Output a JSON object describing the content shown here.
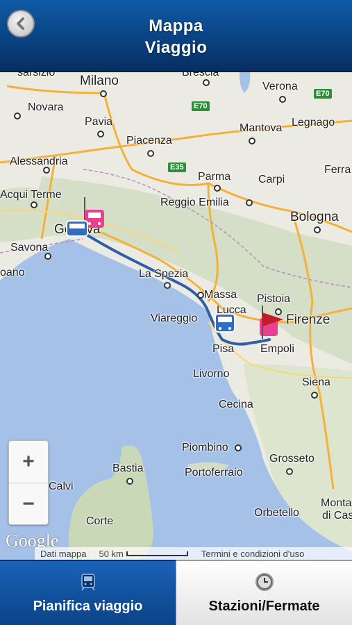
{
  "header": {
    "title_line1": "Mappa",
    "title_line2": "Viaggio",
    "back_icon": "chevron-left-icon"
  },
  "map": {
    "cities": {
      "milano": "Milano",
      "novara": "Novara",
      "pavia": "Pavia",
      "piacenza": "Piacenza",
      "alessandria": "Alessandria",
      "acqui": "Acqui Terme",
      "parma": "Parma",
      "reggio": "Reggio Emilia",
      "bologna": "Bologna",
      "carpi": "Carpi",
      "mantova": "Mantova",
      "legnago": "Legnago",
      "verona": "Verona",
      "brescia": "Brescia",
      "ferrara": "Ferra",
      "genova": "Genova",
      "savona": "Savona",
      "laspezia": "La Spezia",
      "massa": "Massa",
      "viareggio": "Viareggio",
      "lucca": "Lucca",
      "pistoia": "Pistoia",
      "firenze": "Firenze",
      "pisa": "Pisa",
      "empoli": "Empoli",
      "livorno": "Livorno",
      "siena": "Siena",
      "cecina": "Cecina",
      "piombino": "Piombino",
      "portoferraio": "Portoferraio",
      "grosseto": "Grosseto",
      "bastia": "Bastia",
      "calvi": "Calvi",
      "corte": "Corte",
      "orbetello": "Orbetello",
      "monta": "Monta",
      "dicas": "di Cas",
      "loano": "oano",
      "gallarate": "sarsizio"
    },
    "shields": {
      "e70a": "E70",
      "e70b": "E70",
      "e35": "E35"
    },
    "zoom_in": "+",
    "zoom_out": "−",
    "google_logo": "Google",
    "attribution": {
      "data": "Dati mappa",
      "scale": "50 km",
      "terms": "Termini e condizioni d'uso"
    },
    "colors": {
      "route": "#2f5fa8",
      "sea": "#a5c1e8",
      "land": "#ecebe3"
    }
  },
  "tabs": {
    "plan": {
      "label": "Pianifica viaggio",
      "icon": "train-icon"
    },
    "stations": {
      "label": "Stazioni/Fermate",
      "icon": "clock-icon"
    }
  }
}
